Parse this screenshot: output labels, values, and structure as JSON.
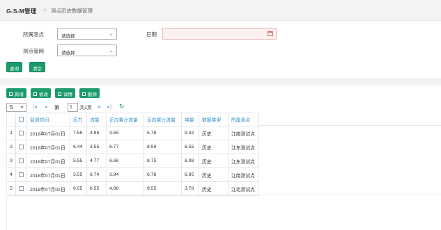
{
  "header": {
    "brand": "G-S-M管理",
    "separator": ">",
    "breadcrumb": "测点历史数据管理"
  },
  "filters": {
    "point_label": "所属测点",
    "point_value": "请选择",
    "network_label": "测点管网",
    "network_value": "请选择",
    "date_label": "日期",
    "date_value": "",
    "query_button": "查询",
    "clear_button": "清空"
  },
  "toolbar": {
    "add": "新增",
    "edit": "修改",
    "detail": "详情",
    "delete": "删除"
  },
  "pager": {
    "page_size": "5",
    "page_prefix": "第",
    "page_number": "1",
    "total_pages": "共1页"
  },
  "table": {
    "columns": [
      "监测时间",
      "压力",
      "流量",
      "正向累计流量",
      "反向累计流量",
      "电量",
      "数据类型",
      "所属测点"
    ],
    "rows": [
      {
        "idx": "1",
        "cells": [
          "2018年07月01日",
          "7.55",
          "4.88",
          "3.69",
          "5.78",
          "9.42",
          "历史",
          "江南测试点"
        ]
      },
      {
        "idx": "2",
        "cells": [
          "2018年07月01日",
          "6.44",
          "3.55",
          "6.77",
          "8.99",
          "6.55",
          "历史",
          "江东测试点"
        ]
      },
      {
        "idx": "3",
        "cells": [
          "2018年07月01日",
          "5.55",
          "4.77",
          "6.66",
          "8.75",
          "6.98",
          "历史",
          "江东测试点"
        ]
      },
      {
        "idx": "4",
        "cells": [
          "2018年07月01日",
          "3.55",
          "6.74",
          "3.94",
          "6.78",
          "6.85",
          "历史",
          "江南测试点"
        ]
      },
      {
        "idx": "5",
        "cells": [
          "2018年07月01日",
          "6.55",
          "6.55",
          "4.88",
          "9.55",
          "3.78",
          "历史",
          "江北测试点"
        ]
      }
    ]
  },
  "colors": {
    "accent_green": "#1c9a6c",
    "header_text_blue": "#2a8fbd",
    "date_field_bg": "#fdf0f0"
  },
  "icons": [
    "chevron-down-icon",
    "calendar-icon",
    "first-page-icon",
    "prev-page-icon",
    "next-page-icon",
    "last-page-icon",
    "refresh-icon"
  ]
}
